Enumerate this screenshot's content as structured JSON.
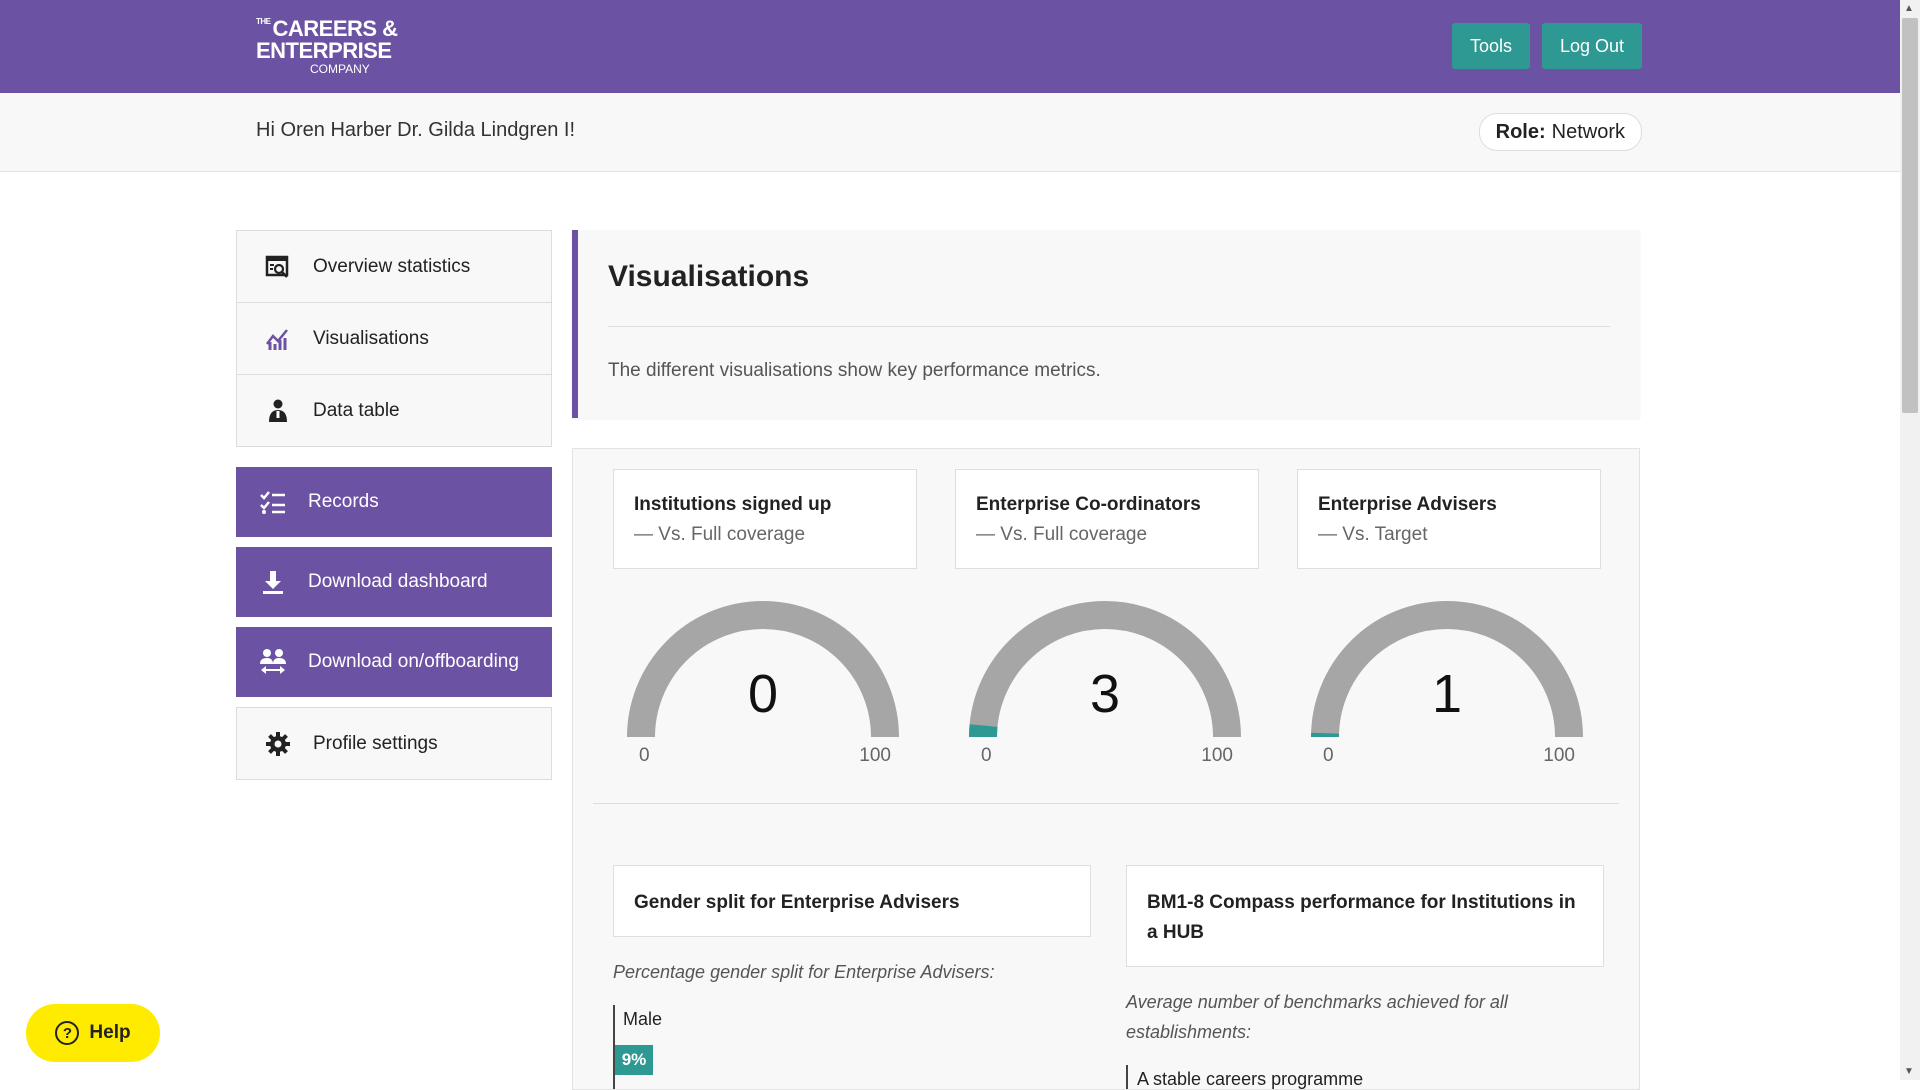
{
  "header": {
    "logo": {
      "line1_prefix": "THE",
      "line1": "CAREERS &",
      "line2": "ENTERPRISE",
      "line3": "COMPANY"
    },
    "tools_label": "Tools",
    "logout_label": "Log Out"
  },
  "subheader": {
    "greeting": "Hi Oren Harber Dr. Gilda Lindgren I!",
    "role_label": "Role:",
    "role_value": "Network"
  },
  "sidebar": {
    "items": [
      {
        "label": "Overview statistics",
        "icon": "magnify-stats-icon"
      },
      {
        "label": "Visualisations",
        "icon": "chart-icon"
      },
      {
        "label": "Data table",
        "icon": "person-icon"
      }
    ],
    "actions": [
      {
        "label": "Records",
        "icon": "checklist-icon"
      },
      {
        "label": "Download dashboard",
        "icon": "download-icon"
      },
      {
        "label": "Download on/offboarding",
        "icon": "people-swap-icon"
      }
    ],
    "profile": {
      "label": "Profile settings",
      "icon": "gear-icon"
    }
  },
  "intro": {
    "title": "Visualisations",
    "description": "The different visualisations show key performance metrics."
  },
  "kpis": [
    {
      "title": "Institutions signed up",
      "subtitle": "— Vs. Full coverage",
      "value": "0",
      "min": "0",
      "max": "100",
      "fraction": 0.0
    },
    {
      "title": "Enterprise Co-ordinators",
      "subtitle": "— Vs. Full coverage",
      "value": "3",
      "min": "0",
      "max": "100",
      "fraction": 0.03
    },
    {
      "title": "Enterprise Advisers",
      "subtitle": "— Vs. Target",
      "value": "1",
      "min": "0",
      "max": "100",
      "fraction": 0.01
    }
  ],
  "gender_card": {
    "title": "Gender split for Enterprise Advisers",
    "description": "Percentage gender split for Enterprise Advisers:",
    "bars": [
      {
        "label": "Male",
        "value_label": "9%",
        "value": 9
      }
    ]
  },
  "compass_card": {
    "title": "BM1-8 Compass performance for Institutions in a HUB",
    "description": "Average number of benchmarks achieved for all establishments:",
    "first_item": "A stable careers programme"
  },
  "help": {
    "label": "Help"
  },
  "colors": {
    "brand_purple": "#6b52a2",
    "teal": "#2e9893",
    "gauge_grey": "#a6a6a6",
    "help_yellow": "#ffeb00"
  }
}
